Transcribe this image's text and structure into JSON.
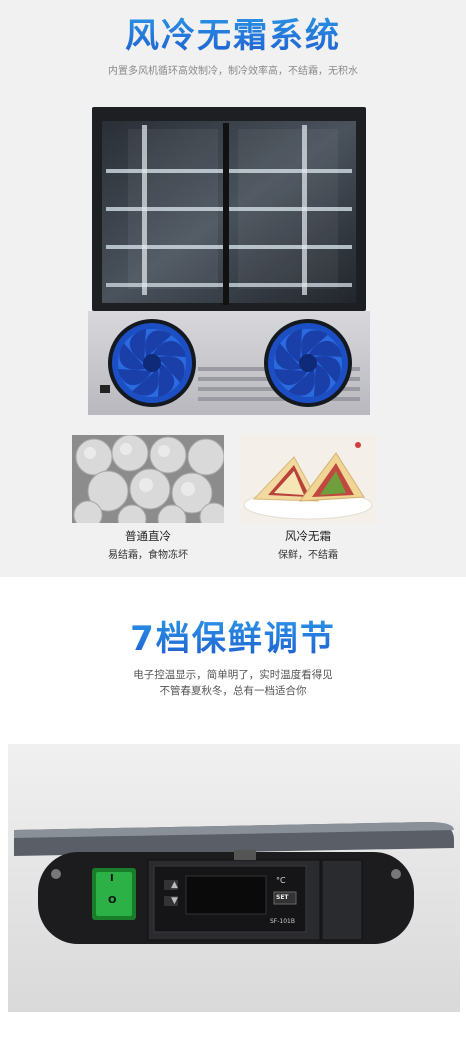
{
  "section1": {
    "title": "风冷无霜系统",
    "subtitle": "内置多风机循环高效制冷，制冷效率高，不结霜，无积水",
    "left_caption": "普通直冷",
    "left_subcaption": "易结霜，食物冻坏",
    "right_caption": "风冷无霜",
    "right_subcaption": "保鲜，不结霜"
  },
  "section2": {
    "title": "7档保鲜调节",
    "line1": "电子控温显示，简单明了，实时温度看得见",
    "line2": "不管春夏秋冬，总有一档适合你"
  },
  "controller": {
    "up_symbol": "▲",
    "down_symbol": "▼",
    "unit": "°C",
    "set_label": "SET",
    "model_label": "SF-101B",
    "switch_on": "I",
    "switch_off": "O"
  },
  "colors": {
    "title_blue": "#1f5fd0",
    "fan_blue": "#1f5fd0",
    "switch_green": "#28a33a"
  }
}
